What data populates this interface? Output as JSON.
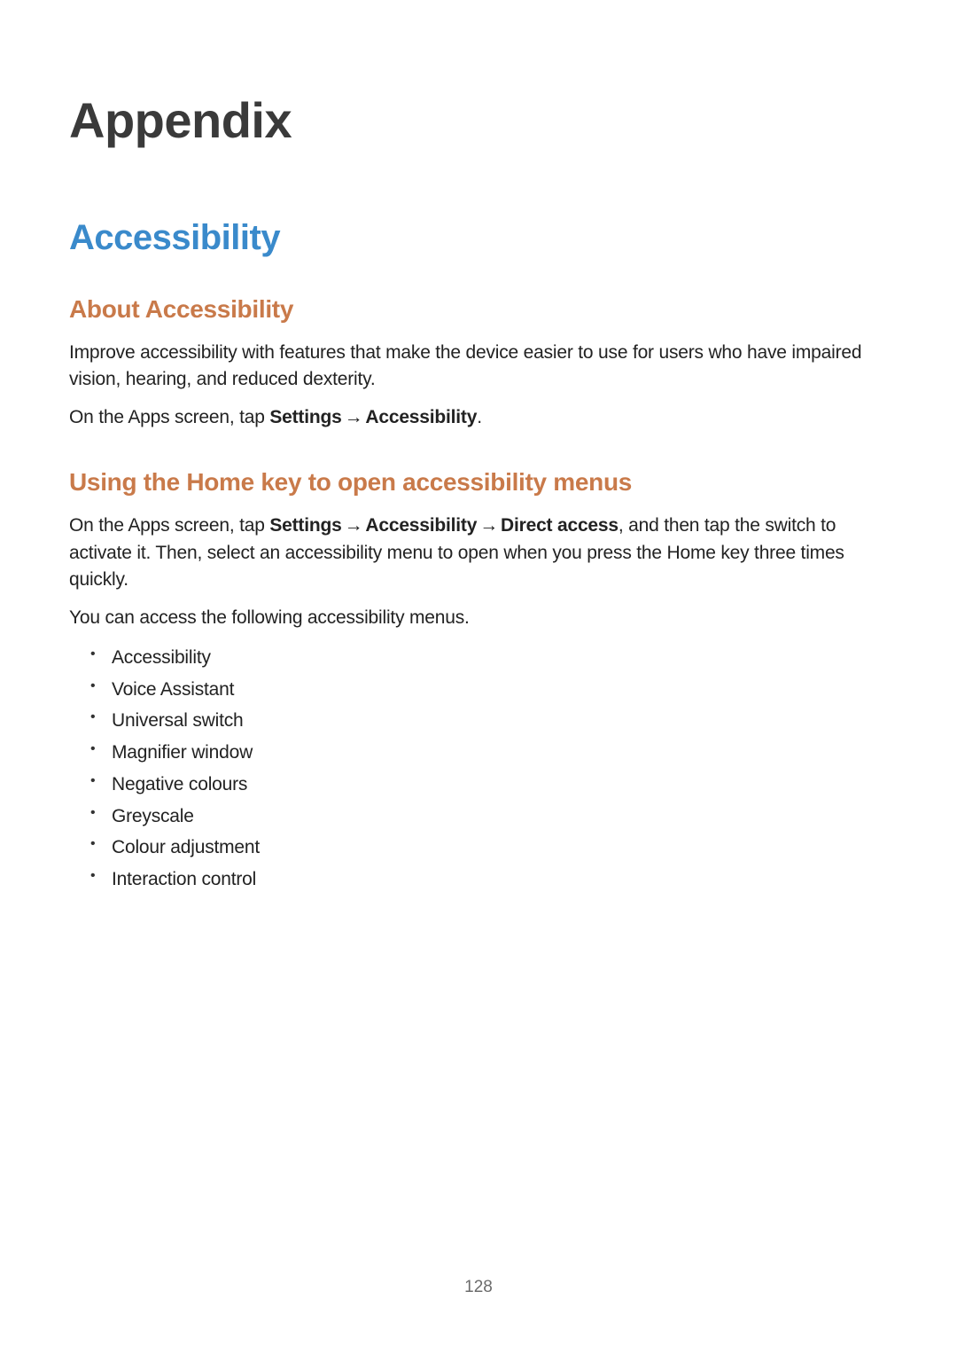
{
  "chapter": {
    "title": "Appendix"
  },
  "section": {
    "title": "Accessibility"
  },
  "subsection1": {
    "title": "About Accessibility",
    "para1": "Improve accessibility with features that make the device easier to use for users who have impaired vision, hearing, and reduced dexterity.",
    "para2_pre": "On the Apps screen, tap ",
    "para2_bold1": "Settings",
    "para2_arrow1": "→",
    "para2_bold2": "Accessibility",
    "para2_period": "."
  },
  "subsection2": {
    "title": "Using the Home key to open accessibility menus",
    "para1_pre": "On the Apps screen, tap ",
    "para1_bold1": "Settings",
    "para1_arrow1": "→",
    "para1_bold2": "Accessibility",
    "para1_arrow2": "→",
    "para1_bold3": "Direct access",
    "para1_rest": ", and then tap the switch to activate it. Then, select an accessibility menu to open when you press the Home key three times quickly.",
    "para2": "You can access the following accessibility menus.",
    "list": [
      "Accessibility",
      "Voice Assistant",
      "Universal switch",
      "Magnifier window",
      "Negative colours",
      "Greyscale",
      "Colour adjustment",
      "Interaction control"
    ]
  },
  "pageNumber": "128"
}
